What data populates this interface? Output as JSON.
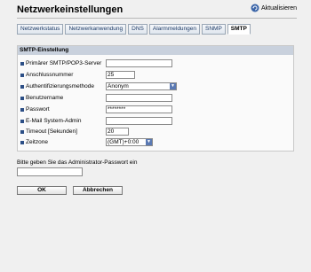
{
  "header": {
    "title": "Netzwerkeinstellungen",
    "refresh_label": "Aktualisieren"
  },
  "tabs": [
    {
      "label": "Netzwerkstatus"
    },
    {
      "label": "Netzwerkanwendung"
    },
    {
      "label": "DNS"
    },
    {
      "label": "Alarmmeldungen"
    },
    {
      "label": "SNMP"
    },
    {
      "label": "SMTP"
    }
  ],
  "active_tab": "SMTP",
  "section": {
    "title": "SMTP-Einstellung",
    "fields": {
      "server": {
        "label": "Primärer SMTP/POP3-Server",
        "value": ""
      },
      "port": {
        "label": "Anschlussnummer",
        "value": "25"
      },
      "auth": {
        "label": "Authentifizierungsmethode",
        "value": "Anonym"
      },
      "user": {
        "label": "Benutzername",
        "value": ""
      },
      "password": {
        "label": "Passwort",
        "value": "********"
      },
      "email": {
        "label": "E-Mail System-Admin",
        "value": ""
      },
      "timeout": {
        "label": "Timeout [Sekunden]",
        "value": "20"
      },
      "timezone": {
        "label": "Zeitzone",
        "value": "(GMT)+0:00"
      }
    }
  },
  "admin_password": {
    "label": "Bitte geben Sie das Administrator-Passwort ein",
    "value": ""
  },
  "buttons": {
    "ok": "OK",
    "cancel": "Abbrechen"
  },
  "colors": {
    "section_header": "#c9d1dd",
    "bullet": "#2c4f86",
    "tab_text": "#1d3a66",
    "select_arrow": "#5a79b3"
  }
}
